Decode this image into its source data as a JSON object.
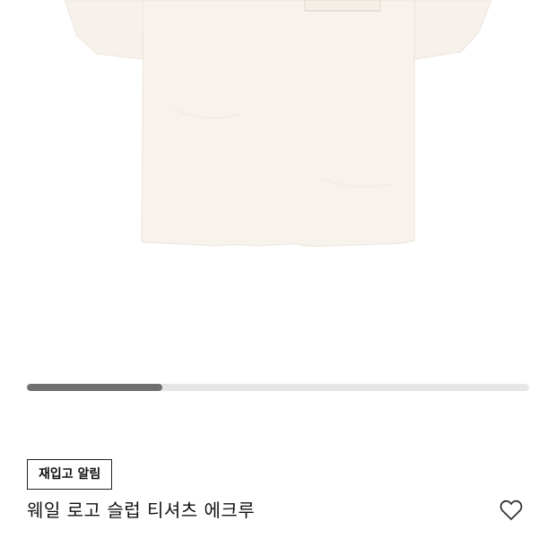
{
  "product": {
    "name": "웨일 로고 슬럽 티셔츠 에크루",
    "color_swatch": "#f5f0e9"
  },
  "gallery": {
    "progress_fraction": 0.27
  },
  "actions": {
    "restock_label": "재입고 알림",
    "wishlist_icon": "heart-outline-icon"
  }
}
